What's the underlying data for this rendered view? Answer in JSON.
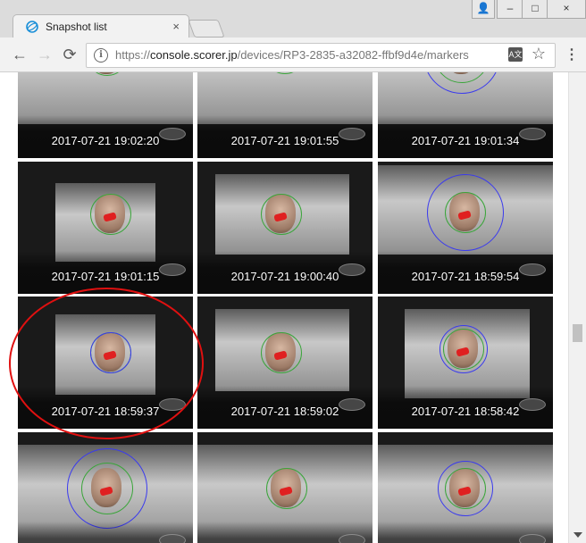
{
  "window": {
    "tab_title": "Snapshot list",
    "tab_close": "×",
    "buttons": {
      "user": "👤",
      "minimize": "–",
      "maximize": "□",
      "close": "×"
    }
  },
  "toolbar": {
    "back": "←",
    "forward": "→",
    "reload": "⟳",
    "url_scheme": "https://",
    "url_host": "console.scorer.jp",
    "url_path": "/devices/RP3-2835-a32082-ffbf9d4e/markers",
    "info": "i",
    "translate": "A文",
    "star": "☆",
    "menu": "⋮"
  },
  "snapshots": [
    "2017-07-21 19:02:20",
    "2017-07-21 19:01:55",
    "2017-07-21 19:01:34",
    "2017-07-21 19:01:15",
    "2017-07-21 19:00:40",
    "2017-07-21 18:59:54",
    "2017-07-21 18:59:37",
    "2017-07-21 18:59:02",
    "2017-07-21 18:58:42",
    "",
    "",
    ""
  ],
  "colors": {
    "annotation": "#e01010",
    "face_ring_green": "#3aa53a",
    "face_ring_blue": "#3a3aee",
    "marker_red": "#e02020"
  },
  "icons": [
    "globe-favicon-icon",
    "user-icon",
    "minimize-icon",
    "maximize-icon",
    "close-icon",
    "back-arrow-icon",
    "forward-arrow-icon",
    "reload-icon",
    "info-icon",
    "translate-icon",
    "star-icon",
    "menu-icon"
  ]
}
